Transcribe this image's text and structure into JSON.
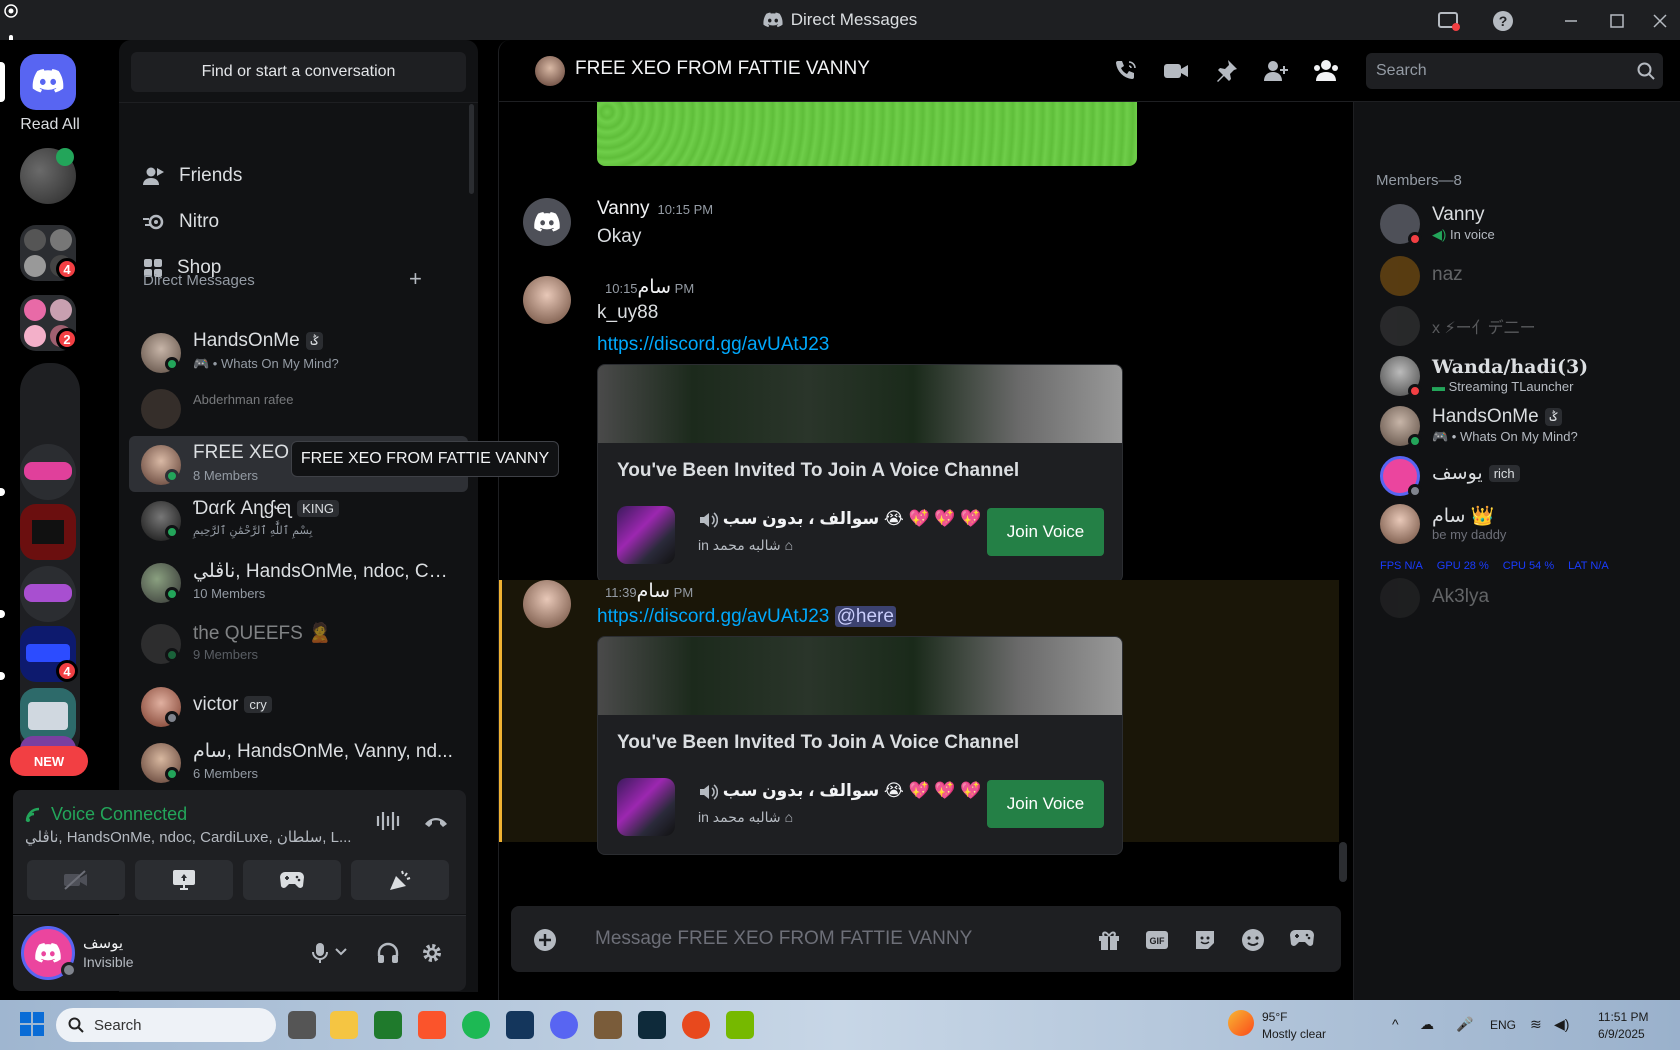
{
  "window": {
    "title": "Direct Messages"
  },
  "servers": {
    "read_all": "Read All",
    "new_label": "NEW",
    "badges": [
      "4",
      "2",
      "4"
    ]
  },
  "dm_sidebar": {
    "find_placeholder": "Find or start a conversation",
    "nav": [
      "Friends",
      "Nitro",
      "Shop"
    ],
    "section_title": "Direct Messages",
    "tooltip": "FREE XEO FROM FATTIE VANNY",
    "rows": [
      {
        "name": "HandsOnMe",
        "tag": "ݣ",
        "sub": "🎮 • Whats On My Mind?"
      },
      {
        "name": "Abderhman rafee",
        "tag": "",
        "sub": ""
      },
      {
        "name": "FREE XEO FROM FATTI...",
        "tag": "",
        "sub": "8 Members"
      },
      {
        "name": "Ɗαɾƙ Αɳɠҽʅ",
        "tag": "KING",
        "sub": "بِسْمِ ٱللَّٰهِ ٱلرَّحْمَٰنِ ٱلرَّحِيمِ"
      },
      {
        "name": "ناڤلي, HandsOnMe, ndoc, Car...",
        "tag": "",
        "sub": "10 Members"
      },
      {
        "name": "the QUEEFS 🙎",
        "tag": "",
        "sub": "9 Members"
      },
      {
        "name": "victor",
        "tag": "cry",
        "sub": ""
      },
      {
        "name": "سام, HandsOnMe, Vanny, nd...",
        "tag": "",
        "sub": "6 Members"
      }
    ]
  },
  "voice": {
    "status": "Voice Connected",
    "channel": "ناڤلي, HandsOnMe, ndoc, CardiLuxe, سلطان, L..."
  },
  "user": {
    "name": "يوسف",
    "status": "Invisible"
  },
  "chat": {
    "header_title": "FREE XEO FROM FATTIE VANNY",
    "search_placeholder": "Search",
    "composer_placeholder": "Message FREE XEO FROM FATTIE VANNY",
    "messages": [
      {
        "author": "Vanny",
        "time": "10:15 PM",
        "text": "Okay"
      },
      {
        "author": "سام",
        "time": "10:15 PM",
        "text": "k_uy88",
        "link": "https://discord.gg/avUAtJ23"
      },
      {
        "author": "سام",
        "time": "11:39 PM",
        "link": "https://discord.gg/avUAtJ23",
        "mention": "@here"
      }
    ],
    "invite": {
      "title": "You've Been Invited To Join A Voice Channel",
      "channel": "سوالف ، بدون سب 😭 💖 💖 💖",
      "server_prefix": "in",
      "server": "شالبه محمد",
      "button": "Join Voice"
    }
  },
  "members": {
    "header": "Members—8",
    "list": [
      {
        "name": "Vanny",
        "sub": "In voice"
      },
      {
        "name": "naz",
        "sub": ""
      },
      {
        "name": "x ⚡ー亻デ二ー",
        "sub": ""
      },
      {
        "name": "Wanda/hadi(3)",
        "sub": "Streaming TLauncher"
      },
      {
        "name": "HandsOnMe",
        "tag": "ݣ",
        "sub": "🎮 • Whats On My Mind?"
      },
      {
        "name": "يوسف",
        "tag": "rich",
        "sub": ""
      },
      {
        "name": "سام 👑",
        "sub": "be my daddy"
      },
      {
        "name": "Ak3lya",
        "sub": ""
      }
    ],
    "overlay": [
      "FPS N/A",
      "GPU 28 %",
      "CPU 54 %",
      "LAT N/A"
    ]
  },
  "taskbar": {
    "search": "Search",
    "weather_temp": "95°F",
    "weather_desc": "Mostly clear",
    "lang": "ENG",
    "time": "11:51 PM",
    "date": "6/9/2025"
  },
  "colors": {
    "accent": "#5865f2",
    "online": "#23a55a",
    "link": "#00a8fc",
    "join": "#248046",
    "badge": "#f23f43"
  }
}
